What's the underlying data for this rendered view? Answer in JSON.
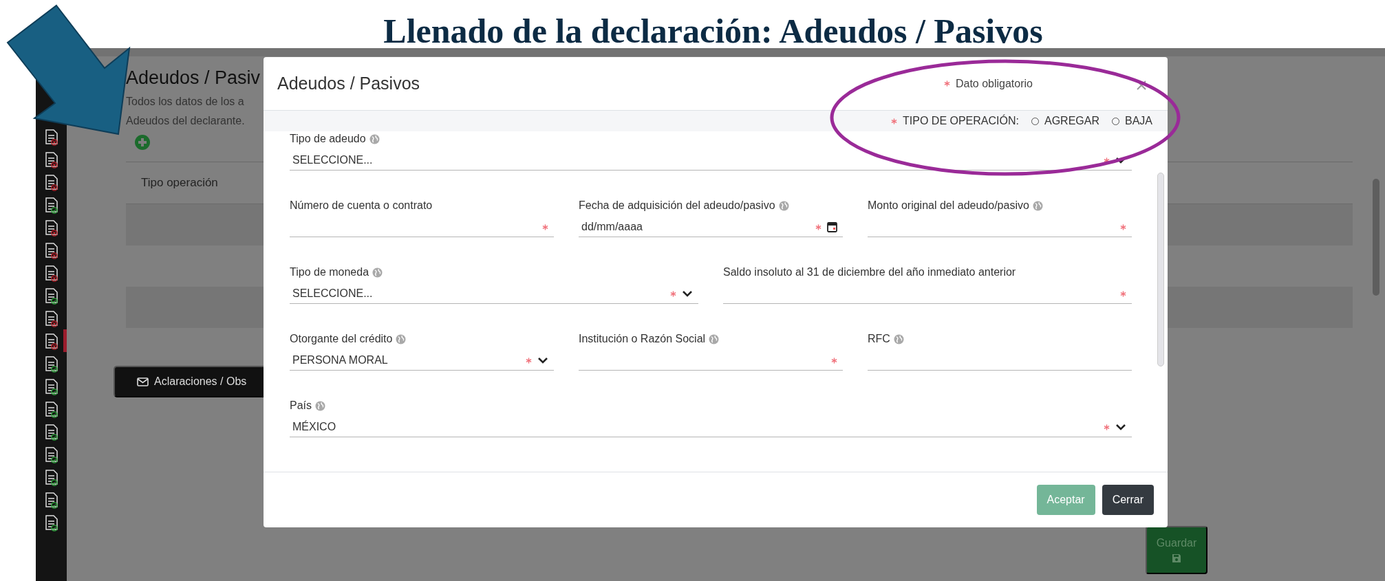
{
  "slide": {
    "title": "Llenado de la declaración: Adeudos / Pasivos"
  },
  "sidebar": {
    "items": [
      {
        "complete": false,
        "selected": false
      },
      {
        "complete": false,
        "selected": false
      },
      {
        "complete": false,
        "selected": false
      },
      {
        "complete": true,
        "selected": false
      },
      {
        "complete": false,
        "selected": false
      },
      {
        "complete": false,
        "selected": false
      },
      {
        "complete": false,
        "selected": false
      },
      {
        "complete": true,
        "selected": false
      },
      {
        "complete": false,
        "selected": false
      },
      {
        "complete": false,
        "selected": true
      },
      {
        "complete": true,
        "selected": false
      },
      {
        "complete": true,
        "selected": false
      },
      {
        "complete": true,
        "selected": false
      },
      {
        "complete": true,
        "selected": false
      },
      {
        "complete": true,
        "selected": false
      },
      {
        "complete": true,
        "selected": false
      },
      {
        "complete": true,
        "selected": false
      },
      {
        "complete": true,
        "selected": false
      }
    ]
  },
  "page": {
    "heading": "Adeudos / Pasiv",
    "description": [
      "Todos los datos de los a",
      "Adeudos del declarante."
    ],
    "table": {
      "columns": [
        "Tipo operación"
      ]
    },
    "notes_button": "Aclaraciones / Obs",
    "save_button": "Guardar"
  },
  "modal": {
    "title": "Adeudos / Pasivos",
    "required_note": "Dato obligatorio",
    "operation": {
      "label": "TIPO DE OPERACIÓN:",
      "options": [
        {
          "label": "AGREGAR",
          "selected": false
        },
        {
          "label": "BAJA",
          "selected": false
        }
      ]
    },
    "rows": [
      [
        {
          "label": "Tipo de adeudo",
          "info": true,
          "kind": "select",
          "value": "SELECCIONE...",
          "required": true
        }
      ],
      [
        {
          "label": "Número de cuenta o contrato",
          "info": false,
          "kind": "text",
          "required": true
        },
        {
          "label": "Fecha de adquisición del adeudo/pasivo",
          "info": true,
          "kind": "date",
          "placeholder": "dd/mm/aaaa",
          "required": true
        },
        {
          "label": "Monto original del adeudo/pasivo",
          "info": true,
          "kind": "text",
          "required": true
        }
      ],
      [
        {
          "label": "Tipo de moneda",
          "info": true,
          "kind": "select",
          "value": "SELECCIONE...",
          "required": true
        },
        {
          "label": "Saldo insoluto al 31 de diciembre del año inmediato anterior",
          "info": false,
          "kind": "text",
          "required": true
        }
      ],
      [
        {
          "label": "Otorgante del crédito",
          "info": true,
          "kind": "select",
          "value": "PERSONA MORAL",
          "required": true
        },
        {
          "label": "Institución o Razón Social",
          "info": true,
          "kind": "text",
          "required": true
        },
        {
          "label": "RFC",
          "info": true,
          "kind": "text",
          "required": false
        }
      ],
      [
        {
          "label": "País",
          "info": true,
          "kind": "select",
          "value": "MÉXICO",
          "required": true
        }
      ]
    ],
    "buttons": [
      {
        "label": "Aceptar",
        "kind": "primary",
        "disabled": true
      },
      {
        "label": "Cerrar",
        "kind": "secondary",
        "disabled": false
      }
    ]
  }
}
